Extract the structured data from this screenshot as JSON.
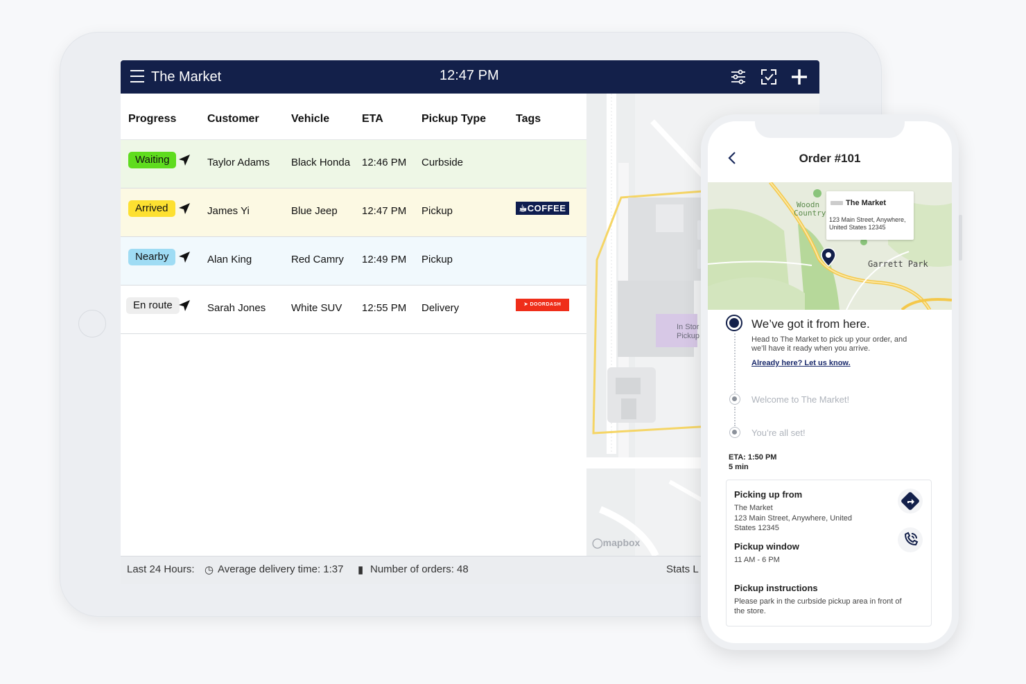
{
  "topbar": {
    "title": "The Market",
    "time": "12:47 PM"
  },
  "table": {
    "headers": [
      "Progress",
      "Customer",
      "Vehicle",
      "ETA",
      "Pickup Type",
      "Tags"
    ],
    "rows": [
      {
        "status": "Waiting",
        "customer": "Taylor Adams",
        "vehicle": "Black Honda",
        "eta": "12:46 PM",
        "pickup": "Curbside",
        "tag": "",
        "row_color": "#eef7e6",
        "badge_color": "#5fdc1e"
      },
      {
        "status": "Arrived",
        "customer": "James Yi",
        "vehicle": "Blue Jeep",
        "eta": "12:47 PM",
        "pickup": "Pickup",
        "tag": "COFFEE",
        "row_color": "#fcf9e3",
        "badge_color": "#fde031"
      },
      {
        "status": "Nearby",
        "customer": "Alan King",
        "vehicle": "Red Camry",
        "eta": "12:49 PM",
        "pickup": "Pickup",
        "tag": "",
        "row_color": "#f1f9fd",
        "badge_color": "#9fdcf4"
      },
      {
        "status": "En route",
        "customer": "Sarah Jones",
        "vehicle": "White SUV",
        "eta": "12:55 PM",
        "pickup": "Delivery",
        "tag": "DOORDASH",
        "row_color": "#ffffff",
        "badge_color": "#eeeeee"
      }
    ]
  },
  "map": {
    "label_line1": "In Stor",
    "label_line2": "Pickup",
    "attribution": "mapbox"
  },
  "footer": {
    "period": "Last 24 Hours:",
    "avg_delivery": "Average delivery time: 1:37",
    "orders": "Number of orders: 48",
    "stats": "Stats L"
  },
  "phone": {
    "order_title": "Order #101",
    "map_card": {
      "name": "The Market",
      "address": "123 Main Street, Anywhere, United States 12345"
    },
    "map_labels": {
      "town1": "Woodn",
      "town1b": "Country",
      "town2": "Garrett Park"
    },
    "steps": {
      "current_title": "We’ve got it from here.",
      "current_desc": "Head to The Market to pick up your order, and we’ll have it ready when you arrive.",
      "current_link": "Already here? Let us know.",
      "next1": "Welcome to The Market!",
      "next2": "You’re all set!"
    },
    "eta_line": "ETA: 1:50 PM",
    "eta_minutes": "5 min",
    "picking_up_from": {
      "heading": "Picking up from",
      "name": "The Market",
      "address": "123 Main Street, Anywhere, United States 12345"
    },
    "pickup_window": {
      "heading": "Pickup window",
      "value": "11 AM - 6 PM"
    },
    "pickup_instructions": {
      "heading": "Pickup instructions",
      "value": "Please park in the curbside pickup area in front of the store."
    }
  }
}
